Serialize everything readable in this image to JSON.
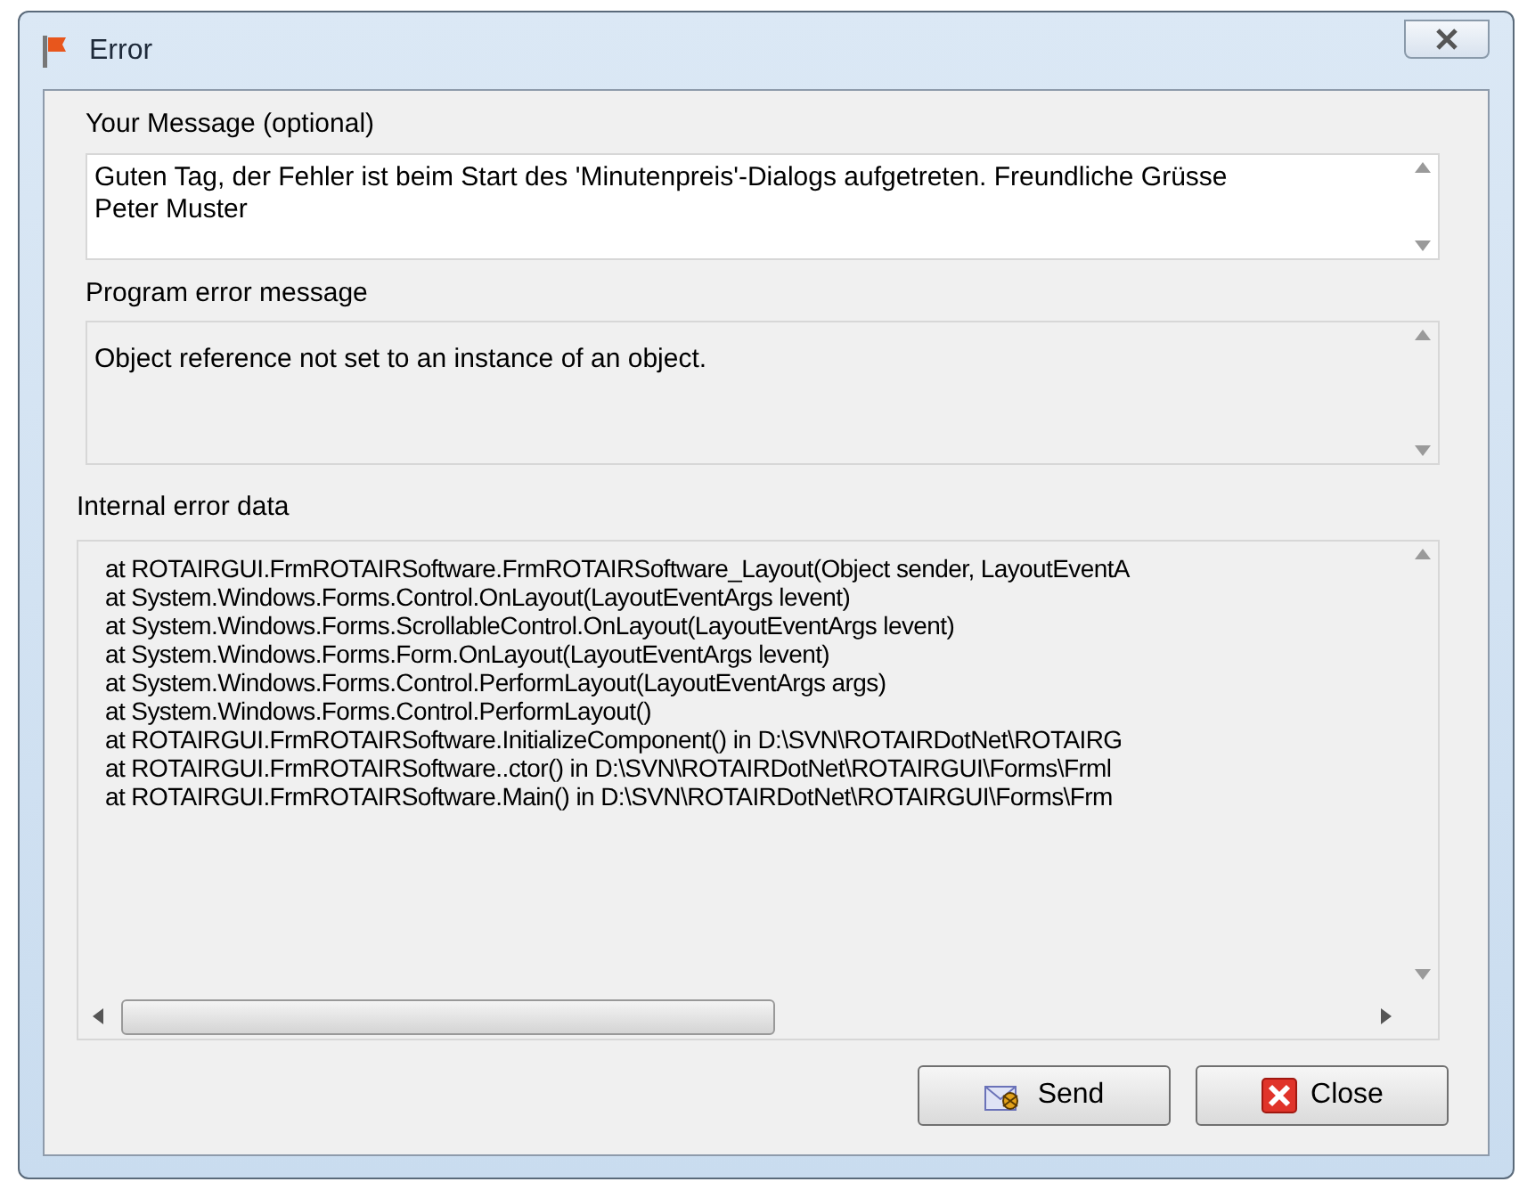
{
  "window": {
    "title": "Error"
  },
  "message": {
    "label": "Your Message (optional)",
    "value": "Guten Tag, der Fehler ist beim Start des 'Minutenpreis'-Dialogs aufgetreten. Freundliche Grüsse\nPeter Muster"
  },
  "program_error": {
    "label": "Program error message",
    "value": "Object reference not set to an instance of an object."
  },
  "internal_error": {
    "label": "Internal error data",
    "lines": [
      "at ROTAIRGUI.FrmROTAIRSoftware.FrmROTAIRSoftware_Layout(Object sender, LayoutEventA",
      "at System.Windows.Forms.Control.OnLayout(LayoutEventArgs levent)",
      "at System.Windows.Forms.ScrollableControl.OnLayout(LayoutEventArgs levent)",
      "at System.Windows.Forms.Form.OnLayout(LayoutEventArgs levent)",
      "at System.Windows.Forms.Control.PerformLayout(LayoutEventArgs args)",
      "at System.Windows.Forms.Control.PerformLayout()",
      "at ROTAIRGUI.FrmROTAIRSoftware.InitializeComponent() in D:\\SVN\\ROTAIRDotNet\\ROTAIRG",
      "at ROTAIRGUI.FrmROTAIRSoftware..ctor() in D:\\SVN\\ROTAIRDotNet\\ROTAIRGUI\\Forms\\Frml",
      "at ROTAIRGUI.FrmROTAIRSoftware.Main() in D:\\SVN\\ROTAIRDotNet\\ROTAIRGUI\\Forms\\Frm"
    ]
  },
  "buttons": [
    {
      "kind": "send",
      "label": "Send"
    },
    {
      "kind": "close",
      "label": "Close"
    }
  ]
}
